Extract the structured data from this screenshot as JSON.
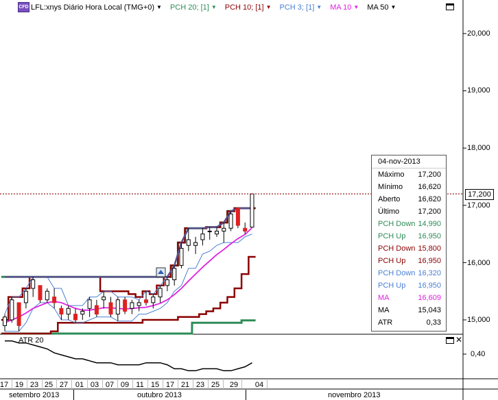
{
  "legend": {
    "badge": "CFD",
    "symbol": "LFL:xnys Diário Hora Local (TMG+0)",
    "items": [
      {
        "label": "PCH 20; [1]",
        "color": "#2e8b57"
      },
      {
        "label": "PCH 10; [1]",
        "color": "#8b0000"
      },
      {
        "label": "PCH 3; [1]",
        "color": "#4a7fd4"
      },
      {
        "label": "MA 10",
        "color": "#e020e0"
      },
      {
        "label": "MA 50",
        "color": "#000000"
      }
    ]
  },
  "price_axis": {
    "labels": [
      "20,000",
      "19,000",
      "18,000",
      "17,000",
      "16,000",
      "15,000"
    ],
    "current_price": "17,200"
  },
  "atr_panel": {
    "label": "ATR 20",
    "axis_label": "0,40"
  },
  "data_window": {
    "date": "04-nov-2013",
    "rows": [
      {
        "k": "Máximo",
        "v": "17,200",
        "color": "#000000"
      },
      {
        "k": "Mínimo",
        "v": "16,620",
        "color": "#000000"
      },
      {
        "k": "Aberto",
        "v": "16,620",
        "color": "#000000"
      },
      {
        "k": "Último",
        "v": "17,200",
        "color": "#000000"
      },
      {
        "k": "PCH Down",
        "v": "14,990",
        "color": "#2e8b57"
      },
      {
        "k": "PCH Up",
        "v": "16,950",
        "color": "#2e8b57"
      },
      {
        "k": "PCH Down",
        "v": "15,800",
        "color": "#8b0000"
      },
      {
        "k": "PCH Up",
        "v": "16,950",
        "color": "#8b0000"
      },
      {
        "k": "PCH Down",
        "v": "16,320",
        "color": "#4a7fd4"
      },
      {
        "k": "PCH Up",
        "v": "16,950",
        "color": "#4a7fd4"
      },
      {
        "k": "MA",
        "v": "16,609",
        "color": "#e020e0"
      },
      {
        "k": "MA",
        "v": "15,043",
        "color": "#000000"
      },
      {
        "k": "ATR",
        "v": "0,33",
        "color": "#000000"
      }
    ]
  },
  "x_axis": {
    "days": [
      "17",
      "19",
      "23",
      "25",
      "27",
      "01",
      "03",
      "07",
      "09",
      "11",
      "15",
      "17",
      "21",
      "23",
      "25",
      "29",
      "04"
    ],
    "months": [
      "setembro 2013",
      "outubro 2013",
      "novembro 2013"
    ]
  },
  "colors": {
    "pch20": "#2e8b57",
    "pch10": "#8b0000",
    "pch3": "#4a7fd4",
    "ma10": "#e020e0",
    "ma50": "#000000",
    "up_body": "#ffffff",
    "down_body": "#e02020",
    "price_line": "#8b0000"
  },
  "chart_data": {
    "type": "candlestick",
    "y_range": [
      14.8,
      20.5
    ],
    "candles": [
      {
        "o": 14.9,
        "h": 15.1,
        "l": 14.8,
        "c": 15.05
      },
      {
        "o": 15.0,
        "h": 15.4,
        "l": 14.95,
        "c": 15.35
      },
      {
        "o": 15.3,
        "h": 15.1,
        "l": 14.8,
        "c": 14.9
      },
      {
        "o": 15.3,
        "h": 15.55,
        "l": 15.2,
        "c": 15.5
      },
      {
        "o": 15.55,
        "h": 15.75,
        "l": 15.4,
        "c": 15.7
      },
      {
        "o": 15.6,
        "h": 15.55,
        "l": 15.3,
        "c": 15.35
      },
      {
        "o": 15.35,
        "h": 15.55,
        "l": 15.3,
        "c": 15.5
      },
      {
        "o": 15.4,
        "h": 15.55,
        "l": 15.2,
        "c": 15.3
      },
      {
        "o": 15.2,
        "h": 15.25,
        "l": 15.0,
        "c": 15.1
      },
      {
        "o": 15.1,
        "h": 15.25,
        "l": 15.0,
        "c": 15.2
      },
      {
        "o": 15.1,
        "h": 15.2,
        "l": 14.95,
        "c": 15.0
      },
      {
        "o": 15.1,
        "h": 15.2,
        "l": 15.0,
        "c": 15.15
      },
      {
        "o": 15.2,
        "h": 15.4,
        "l": 15.05,
        "c": 15.35
      },
      {
        "o": 15.25,
        "h": 15.35,
        "l": 15.05,
        "c": 15.1
      },
      {
        "o": 15.35,
        "h": 15.5,
        "l": 15.2,
        "c": 15.4
      },
      {
        "o": 15.3,
        "h": 15.4,
        "l": 15.05,
        "c": 15.1
      },
      {
        "o": 15.1,
        "h": 15.4,
        "l": 14.98,
        "c": 15.35
      },
      {
        "o": 15.35,
        "h": 15.4,
        "l": 15.1,
        "c": 15.15
      },
      {
        "o": 15.2,
        "h": 15.35,
        "l": 15.1,
        "c": 15.3
      },
      {
        "o": 15.25,
        "h": 15.35,
        "l": 15.15,
        "c": 15.3
      },
      {
        "o": 15.35,
        "h": 15.5,
        "l": 15.25,
        "c": 15.3
      },
      {
        "o": 15.3,
        "h": 15.45,
        "l": 15.2,
        "c": 15.4
      },
      {
        "o": 15.4,
        "h": 15.6,
        "l": 15.3,
        "c": 15.55
      },
      {
        "o": 15.6,
        "h": 15.75,
        "l": 15.5,
        "c": 15.7
      },
      {
        "o": 15.7,
        "h": 15.95,
        "l": 15.6,
        "c": 15.9
      },
      {
        "o": 15.95,
        "h": 16.35,
        "l": 15.9,
        "c": 16.25
      },
      {
        "o": 16.3,
        "h": 16.6,
        "l": 16.2,
        "c": 16.4
      },
      {
        "o": 16.3,
        "h": 16.45,
        "l": 16.15,
        "c": 16.35
      },
      {
        "o": 16.4,
        "h": 16.6,
        "l": 16.3,
        "c": 16.5
      },
      {
        "o": 16.55,
        "h": 16.62,
        "l": 16.4,
        "c": 16.55
      },
      {
        "o": 16.5,
        "h": 16.62,
        "l": 16.45,
        "c": 16.55
      },
      {
        "o": 16.55,
        "h": 16.7,
        "l": 16.35,
        "c": 16.6
      },
      {
        "o": 16.6,
        "h": 16.9,
        "l": 16.55,
        "c": 16.85
      },
      {
        "o": 16.95,
        "h": 16.95,
        "l": 16.6,
        "c": 16.65
      },
      {
        "o": 16.6,
        "h": 16.7,
        "l": 16.5,
        "c": 16.55
      },
      {
        "o": 16.62,
        "h": 17.2,
        "l": 16.62,
        "c": 17.2
      }
    ],
    "pch20_up": [
      15.75,
      15.75,
      15.75,
      15.75,
      15.75,
      15.75,
      15.75,
      15.75,
      15.75,
      15.75,
      15.75,
      15.75,
      15.75,
      15.75,
      15.75,
      15.75,
      15.75,
      15.75,
      15.75,
      15.75,
      15.75,
      15.75,
      15.75,
      15.75,
      15.95,
      16.35,
      16.6,
      16.6,
      16.6,
      16.62,
      16.62,
      16.7,
      16.9,
      16.95,
      16.95,
      16.95
    ],
    "pch20_down": [
      14.7,
      14.7,
      14.7,
      14.7,
      14.7,
      14.7,
      14.7,
      14.7,
      14.7,
      14.7,
      14.7,
      14.7,
      14.7,
      14.7,
      14.7,
      14.7,
      14.7,
      14.7,
      14.7,
      14.7,
      14.7,
      14.7,
      14.7,
      14.7,
      14.7,
      14.7,
      14.7,
      14.95,
      14.95,
      14.95,
      14.95,
      14.95,
      14.95,
      14.95,
      14.99,
      14.99
    ],
    "pch10_up": [
      15.0,
      15.4,
      15.4,
      15.55,
      15.75,
      15.75,
      15.75,
      15.75,
      15.75,
      15.75,
      15.75,
      15.75,
      15.75,
      15.75,
      15.5,
      15.5,
      15.5,
      15.5,
      15.45,
      15.4,
      15.5,
      15.45,
      15.6,
      15.75,
      15.95,
      16.35,
      16.6,
      16.6,
      16.6,
      16.62,
      16.62,
      16.7,
      16.9,
      16.95,
      16.95,
      16.95
    ],
    "pch10_down": [
      14.5,
      14.55,
      14.6,
      14.65,
      14.7,
      14.7,
      14.75,
      14.8,
      14.95,
      14.95,
      14.95,
      14.95,
      14.95,
      14.95,
      14.95,
      14.95,
      14.95,
      14.95,
      14.95,
      14.95,
      15.0,
      15.0,
      15.0,
      15.0,
      15.0,
      15.05,
      15.05,
      15.05,
      15.1,
      15.15,
      15.2,
      15.3,
      15.4,
      15.55,
      15.8,
      16.1
    ],
    "pch3_up": [
      15.1,
      15.4,
      15.4,
      15.55,
      15.75,
      15.75,
      15.75,
      15.55,
      15.55,
      15.25,
      15.25,
      15.25,
      15.4,
      15.4,
      15.5,
      15.5,
      15.4,
      15.4,
      15.4,
      15.35,
      15.5,
      15.45,
      15.6,
      15.75,
      15.95,
      16.35,
      16.6,
      16.6,
      16.6,
      16.62,
      16.62,
      16.7,
      16.9,
      16.95,
      16.95,
      16.95
    ],
    "pch3_down": [
      14.8,
      14.8,
      14.8,
      14.95,
      15.2,
      15.3,
      15.3,
      15.2,
      15.0,
      15.0,
      14.95,
      14.95,
      15.0,
      15.05,
      15.05,
      15.05,
      14.98,
      14.98,
      14.98,
      15.1,
      15.1,
      15.15,
      15.2,
      15.3,
      15.5,
      15.6,
      15.9,
      15.9,
      16.15,
      16.2,
      16.3,
      16.35,
      16.35,
      16.35,
      16.45,
      16.5
    ],
    "ma10": [
      14.95,
      15.0,
      15.05,
      15.12,
      15.2,
      15.25,
      15.3,
      15.32,
      15.3,
      15.25,
      15.2,
      15.17,
      15.17,
      15.19,
      15.21,
      15.21,
      15.2,
      15.19,
      15.2,
      15.21,
      15.22,
      15.25,
      15.29,
      15.35,
      15.44,
      15.55,
      15.68,
      15.8,
      15.92,
      16.03,
      16.14,
      16.23,
      16.33,
      16.42,
      16.49,
      16.61
    ],
    "atr": [
      0.44,
      0.44,
      0.43,
      0.43,
      0.42,
      0.41,
      0.4,
      0.38,
      0.37,
      0.36,
      0.35,
      0.35,
      0.34,
      0.33,
      0.33,
      0.33,
      0.32,
      0.32,
      0.32,
      0.32,
      0.33,
      0.33,
      0.33,
      0.32,
      0.3,
      0.3,
      0.29,
      0.29,
      0.3,
      0.3,
      0.3,
      0.29,
      0.29,
      0.3,
      0.31,
      0.33
    ],
    "atr_range": [
      0.26,
      0.46
    ]
  }
}
